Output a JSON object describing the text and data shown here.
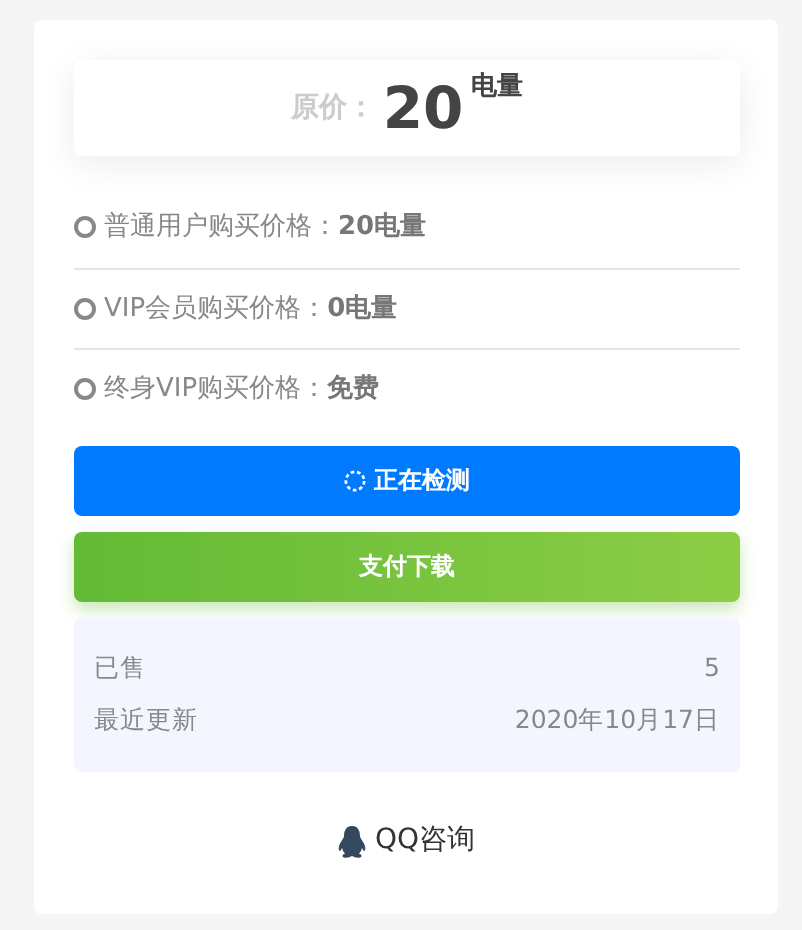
{
  "price_box": {
    "label": "原价：",
    "amount": "20",
    "unit": "电量"
  },
  "price_rows": [
    {
      "text": "普通用户购买价格：**20电量**"
    },
    {
      "text": "VIP会员购买价格：**0电量**"
    },
    {
      "text": "终身VIP购买价格：**免费**"
    }
  ],
  "buttons": [
    {
      "kind": "loading",
      "label": "正在检测"
    },
    {
      "kind": "pay",
      "label": "支付下载"
    }
  ],
  "info": [
    {
      "label": "已售",
      "value": "5"
    },
    {
      "label": "最近更新",
      "value": "2020年10月17日"
    }
  ],
  "contact": {
    "label": "QQ咨询"
  }
}
